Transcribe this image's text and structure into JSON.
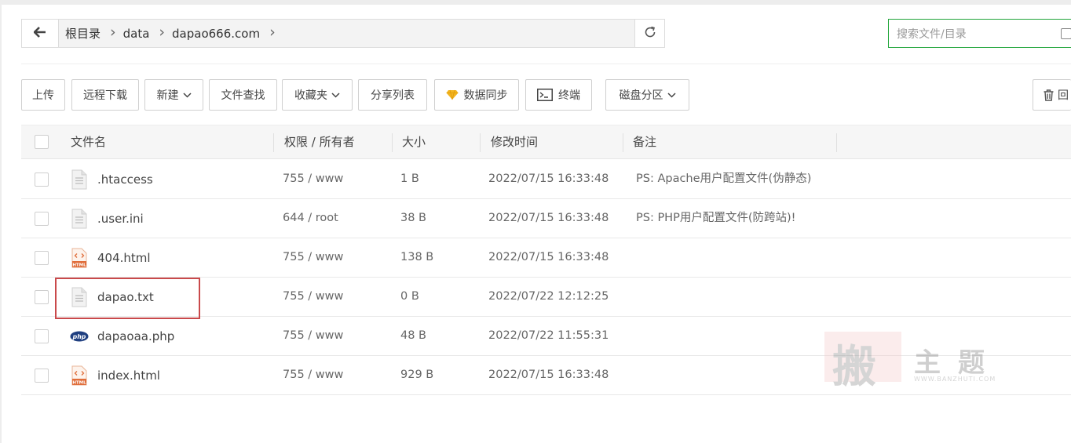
{
  "path": {
    "crumbs": [
      "根目录",
      "data",
      "dapao666.com"
    ]
  },
  "search": {
    "placeholder": "搜索文件/目录"
  },
  "toolbar": {
    "upload": "上传",
    "remote_download": "远程下载",
    "new": "新建",
    "file_search": "文件查找",
    "favorites": "收藏夹",
    "share_list": "分享列表",
    "data_sync": "数据同步",
    "terminal": "终端",
    "disk_partition": "磁盘分区",
    "recycle": "回"
  },
  "table": {
    "headers": {
      "name": "文件名",
      "perm": "权限 / 所有者",
      "size": "大小",
      "mtime": "修改时间",
      "note": "备注"
    },
    "rows": [
      {
        "name": ".htaccess",
        "icon": "file-text-icon",
        "perm": "755 / www",
        "size": "1 B",
        "mtime": "2022/07/15 16:33:48",
        "note": "PS: Apache用户配置文件(伪静态)"
      },
      {
        "name": ".user.ini",
        "icon": "file-text-icon",
        "perm": "644 / root",
        "size": "38 B",
        "mtime": "2022/07/15 16:33:48",
        "note": "PS: PHP用户配置文件(防跨站)!"
      },
      {
        "name": "404.html",
        "icon": "html-file-icon",
        "perm": "755 / www",
        "size": "138 B",
        "mtime": "2022/07/15 16:33:48",
        "note": ""
      },
      {
        "name": "dapao.txt",
        "icon": "file-text-icon",
        "perm": "755 / www",
        "size": "0 B",
        "mtime": "2022/07/22 12:12:25",
        "note": ""
      },
      {
        "name": "dapaoaa.php",
        "icon": "php-file-icon",
        "perm": "755 / www",
        "size": "48 B",
        "mtime": "2022/07/22 11:55:31",
        "note": ""
      },
      {
        "name": "index.html",
        "icon": "html-file-icon",
        "perm": "755 / www",
        "size": "929 B",
        "mtime": "2022/07/15 16:33:48",
        "note": ""
      }
    ]
  },
  "watermark": {
    "text": "搬主题",
    "url": "WWW.BANZHUTI.COM"
  },
  "colors": {
    "accent": "#20a53a",
    "highlight": "#c9494b",
    "header_bg": "#f6f6f6",
    "html_icon": "#e06d3a",
    "php_icon": "#1f3f80"
  }
}
